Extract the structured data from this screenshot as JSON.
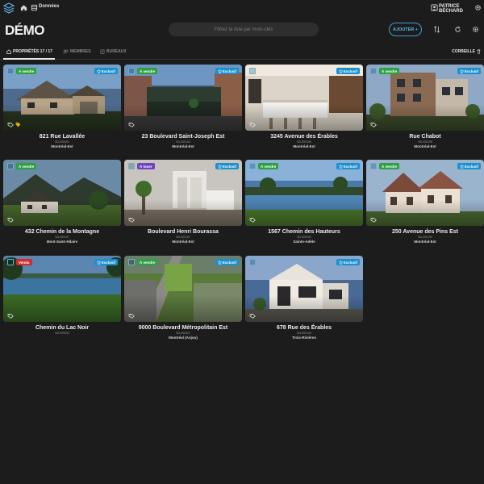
{
  "topbar": {
    "breadcrumb": "Données",
    "user": "PATRICE BÉCHARD"
  },
  "header": {
    "title": "DÉMO",
    "search_placeholder": "Filtrez la liste par mots-clés",
    "add_label": "AJOUTER +"
  },
  "tabs": [
    {
      "label": "PROPRIÉTÉS 17 / 17",
      "icon": "home-icon"
    },
    {
      "label": "MEMBRES",
      "icon": "users-icon"
    },
    {
      "label": "BUREAUX",
      "icon": "building-icon"
    }
  ],
  "trash_label": "CORBEILLE",
  "exclusive_label": "Exclusif",
  "colors": {
    "for_sale": "#2ea043",
    "for_rent": "#6f42c1",
    "sold": "#d12b2b",
    "accent": "#3aa0d8"
  },
  "properties": [
    {
      "address": "821 Rue Lavallée",
      "code": "SD-000001",
      "city": "Montréal-Est",
      "status": "À vendre",
      "status_type": "for_sale",
      "exclusive": true,
      "scene": "house",
      "extra_tag": true
    },
    {
      "address": "23 Boulevard Saint-Joseph Est",
      "code": "SD-000194",
      "city": "Montréal-Est",
      "status": "À vendre",
      "status_type": "for_sale",
      "exclusive": true,
      "scene": "street",
      "extra_tag": false
    },
    {
      "address": "3245 Avenue des Érables",
      "code": "SD-000196",
      "city": "Montréal-Est",
      "status": "",
      "status_type": "",
      "exclusive": true,
      "scene": "kitchen",
      "extra_tag": false
    },
    {
      "address": "Rue Chabot",
      "code": "SD-000195",
      "city": "Montréal-Est",
      "status": "À vendre",
      "status_type": "for_sale",
      "exclusive": true,
      "scene": "modern",
      "extra_tag": false
    },
    {
      "address": "432 Chemin de la Montagne",
      "code": "SD-000197",
      "city": "Mont-Saint-Hilaire",
      "status": "À vendre",
      "status_type": "for_sale",
      "exclusive": false,
      "scene": "mountain",
      "extra_tag": false
    },
    {
      "address": "Boulevard Henri Bourassa",
      "code": "SD-000197",
      "city": "Montréal-Est",
      "status": "À louer",
      "status_type": "for_rent",
      "exclusive": true,
      "scene": "interior",
      "extra_tag": false
    },
    {
      "address": "1567 Chemin des Hauteurs",
      "code": "SD-000032",
      "city": "Sainte-Adèle",
      "status": "À vendre",
      "status_type": "for_sale",
      "exclusive": true,
      "scene": "lake",
      "extra_tag": false
    },
    {
      "address": "250 Avenue des Pins Est",
      "code": "SD-000193",
      "city": "Montréal-Est",
      "status": "À vendre",
      "status_type": "for_sale",
      "exclusive": true,
      "scene": "victorian",
      "extra_tag": false
    },
    {
      "address": "Chemin du Lac Noir",
      "code": "SD-000003",
      "city": "",
      "status": "Vendu",
      "status_type": "sold",
      "exclusive": true,
      "scene": "lakeview",
      "extra_tag": false
    },
    {
      "address": "9000 Boulevard Métropolitain Est",
      "code": "SD-000021",
      "city": "Montréal (Anjou)",
      "status": "À vendre",
      "status_type": "for_sale",
      "exclusive": true,
      "scene": "aerial",
      "extra_tag": false
    },
    {
      "address": "678 Rue des Érables",
      "code": "SD-000199",
      "city": "Trois-Rivières",
      "status": "",
      "status_type": "",
      "exclusive": true,
      "scene": "contemporary",
      "extra_tag": false
    }
  ]
}
